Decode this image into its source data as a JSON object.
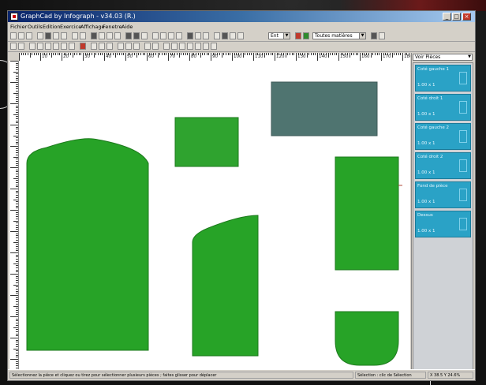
{
  "window": {
    "title": "GraphCad by Infograph - v34.03 (R.)",
    "controls": {
      "minimize": "_",
      "maximize": "□",
      "close": "×"
    }
  },
  "menu": {
    "items": [
      "Fichier",
      "Outils",
      "Edition",
      "Exercice",
      "Affichage",
      "Fenetre",
      "Aide"
    ]
  },
  "toolbar": {
    "zoom_value": "Ent",
    "layer_value": "Toutes matières"
  },
  "ruler": {
    "labels": [
      "10",
      "20",
      "30",
      "40",
      "50",
      "60",
      "70",
      "80",
      "90",
      "100",
      "110",
      "120",
      "130",
      "140",
      "150",
      "160",
      "170",
      "180"
    ]
  },
  "panel": {
    "header": "Voir Pièces",
    "pieces": [
      {
        "name": "Coté gauche 1",
        "value": "1.00 x 1"
      },
      {
        "name": "Coté droit 1",
        "value": "1.00 x 1"
      },
      {
        "name": "Coté gauche 2",
        "value": "1.00 x 1"
      },
      {
        "name": "Coté droit 2",
        "value": "1.00 x 1"
      },
      {
        "name": "Fond de pièce",
        "value": "1.00 x 1"
      },
      {
        "name": "Dessus",
        "value": "1.00 x 1"
      }
    ]
  },
  "status": {
    "message": "Sélectionnez la pièce et cliquez ou tirez pour sélectionner plusieurs pièces ; faites glisser pour déplacer",
    "mode": "Sélection : clic de Sélection",
    "coords": "X 38.5 Y 24.6%"
  },
  "colors": {
    "piece_green": "#27a327",
    "piece_stroke": "#1d7a1d",
    "piece_gray": "#4f7470",
    "panel_item": "#2aa2c6",
    "titlebar": "#0a246a"
  },
  "icons": [
    "new-file-icon",
    "open-icon",
    "save-icon",
    "print-icon",
    "undo-icon",
    "redo-icon",
    "zoom-in-icon",
    "zoom-out-icon",
    "grid-icon",
    "text-icon"
  ]
}
